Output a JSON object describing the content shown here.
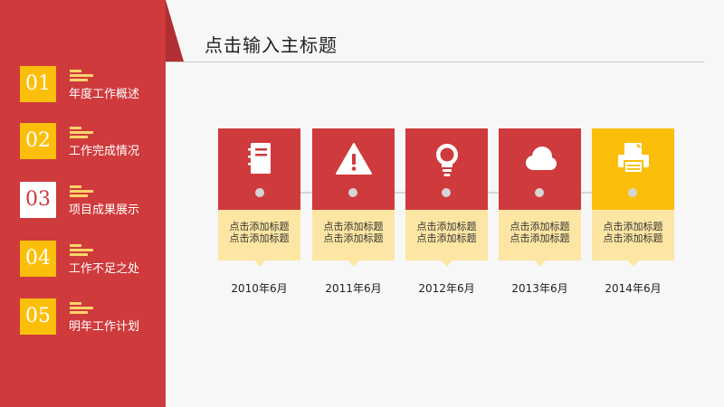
{
  "header": {
    "title": "点击输入主标题"
  },
  "nav": [
    {
      "num": "01",
      "label": "年度工作概述"
    },
    {
      "num": "02",
      "label": "工作完成情况"
    },
    {
      "num": "03",
      "label": "项目成果展示"
    },
    {
      "num": "04",
      "label": "工作不足之处"
    },
    {
      "num": "05",
      "label": "明年工作计划"
    }
  ],
  "timeline": [
    {
      "icon": "notebook-icon",
      "line1": "点击添加标题",
      "line2": "点击添加标题",
      "date": "2010年6月"
    },
    {
      "icon": "warning-icon",
      "line1": "点击添加标题",
      "line2": "点击添加标题",
      "date": "2011年6月"
    },
    {
      "icon": "lightbulb-icon",
      "line1": "点击添加标题",
      "line2": "点击添加标题",
      "date": "2012年6月"
    },
    {
      "icon": "cloud-icon",
      "line1": "点击添加标题",
      "line2": "点击添加标题",
      "date": "2013年6月"
    },
    {
      "icon": "printer-icon",
      "line1": "点击添加标题",
      "line2": "点击添加标题",
      "date": "2014年6月"
    }
  ],
  "colors": {
    "primary": "#cf3a3c",
    "accent": "#fbbf0b",
    "card_text_bg": "#fde6a3",
    "bars": "#fbd36a"
  }
}
